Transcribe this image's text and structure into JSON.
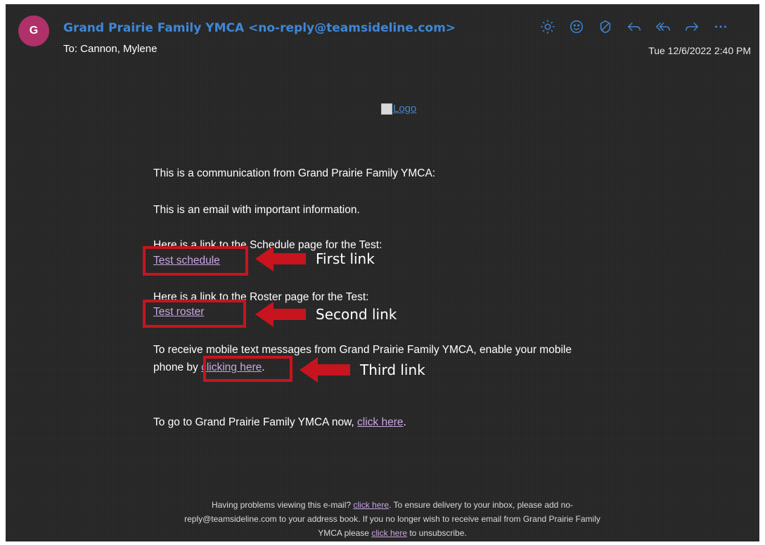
{
  "header": {
    "avatar_letter": "G",
    "sender": "Grand Prairie Family YMCA <no-reply@teamsideline.com>",
    "to_line": "To:  Cannon, Mylene",
    "timestamp": "Tue 12/6/2022 2:40 PM",
    "toolbar_icons": [
      "brightness-icon",
      "emoji-icon",
      "sensitivity-icon",
      "reply-icon",
      "reply-all-icon",
      "forward-icon",
      "more-icon"
    ]
  },
  "body": {
    "logo_alt": "Logo",
    "intro": "This is a communication from Grand Prairie Family YMCA:",
    "important": "This is an email with important information.",
    "schedule_intro": "Here is a link to the Schedule page for the Test:",
    "schedule_link": "Test schedule",
    "roster_intro": "Here is a link to the Roster page for the Test:",
    "roster_link": "Test roster",
    "mobile_text_line1": "To receive mobile text messages from Grand Prairie Family YMCA, enable your mobile",
    "mobile_text_prefix": "phone by ",
    "mobile_link": "clicking here",
    "mobile_suffix": ".",
    "goto_prefix": "To go to Grand Prairie Family YMCA now, ",
    "goto_link": "click here",
    "goto_suffix": "."
  },
  "annotations": {
    "first": "First link",
    "second": "Second  link",
    "third": "Third link",
    "color": "#c8141e"
  },
  "footer": {
    "part1": "Having problems viewing this e-mail? ",
    "link1": "click here",
    "part2": ". To ensure delivery to your inbox, please add no-",
    "part3": "reply@teamsideline.com to your address book. If you no longer wish to receive email from Grand Prairie Family",
    "part4": "YMCA please ",
    "link2": "click here",
    "part5": " to unsubscribe."
  },
  "colors": {
    "background": "#252525",
    "sender": "#3f87d6",
    "link": "#c9a6e0",
    "avatar": "#b0306a"
  }
}
